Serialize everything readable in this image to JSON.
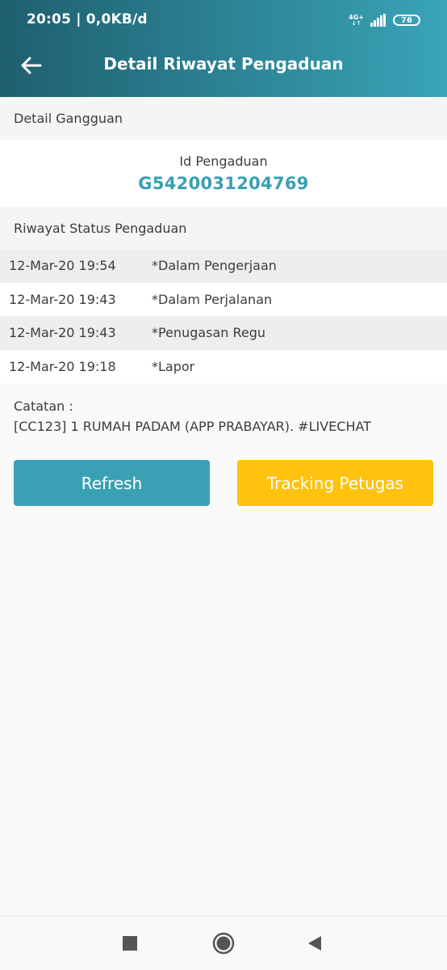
{
  "statusbar": {
    "time": "20:05 | 0,0KB/d",
    "network": "4G+",
    "network_arrows": "↓↑",
    "battery": "76"
  },
  "header": {
    "title": "Detail Riwayat Pengaduan",
    "back_icon": "arrow-left-icon"
  },
  "detail": {
    "section_title": "Detail Gangguan",
    "id_label": "Id Pengaduan",
    "id_value": "G5420031204769"
  },
  "history": {
    "section_title": "Riwayat Status Pengaduan",
    "rows": [
      {
        "date": "12-Mar-20 19:54",
        "status": "*Dalam Pengerjaan"
      },
      {
        "date": "12-Mar-20 19:43",
        "status": "*Dalam Perjalanan"
      },
      {
        "date": "12-Mar-20 19:43",
        "status": "*Penugasan Regu"
      },
      {
        "date": "12-Mar-20 19:18",
        "status": "*Lapor"
      }
    ]
  },
  "note": {
    "label": "Catatan :",
    "text": "[CC123] 1 RUMAH PADAM (APP PRABAYAR). #LIVECHAT"
  },
  "actions": {
    "refresh_label": "Refresh",
    "tracking_label": "Tracking Petugas"
  },
  "colors": {
    "primary": "#3aa1b5",
    "accent": "#ffc20e",
    "header_dark": "#1f5f6e"
  },
  "navbar": {
    "icons": [
      "square-recent-icon",
      "circle-home-icon",
      "triangle-back-icon"
    ]
  }
}
